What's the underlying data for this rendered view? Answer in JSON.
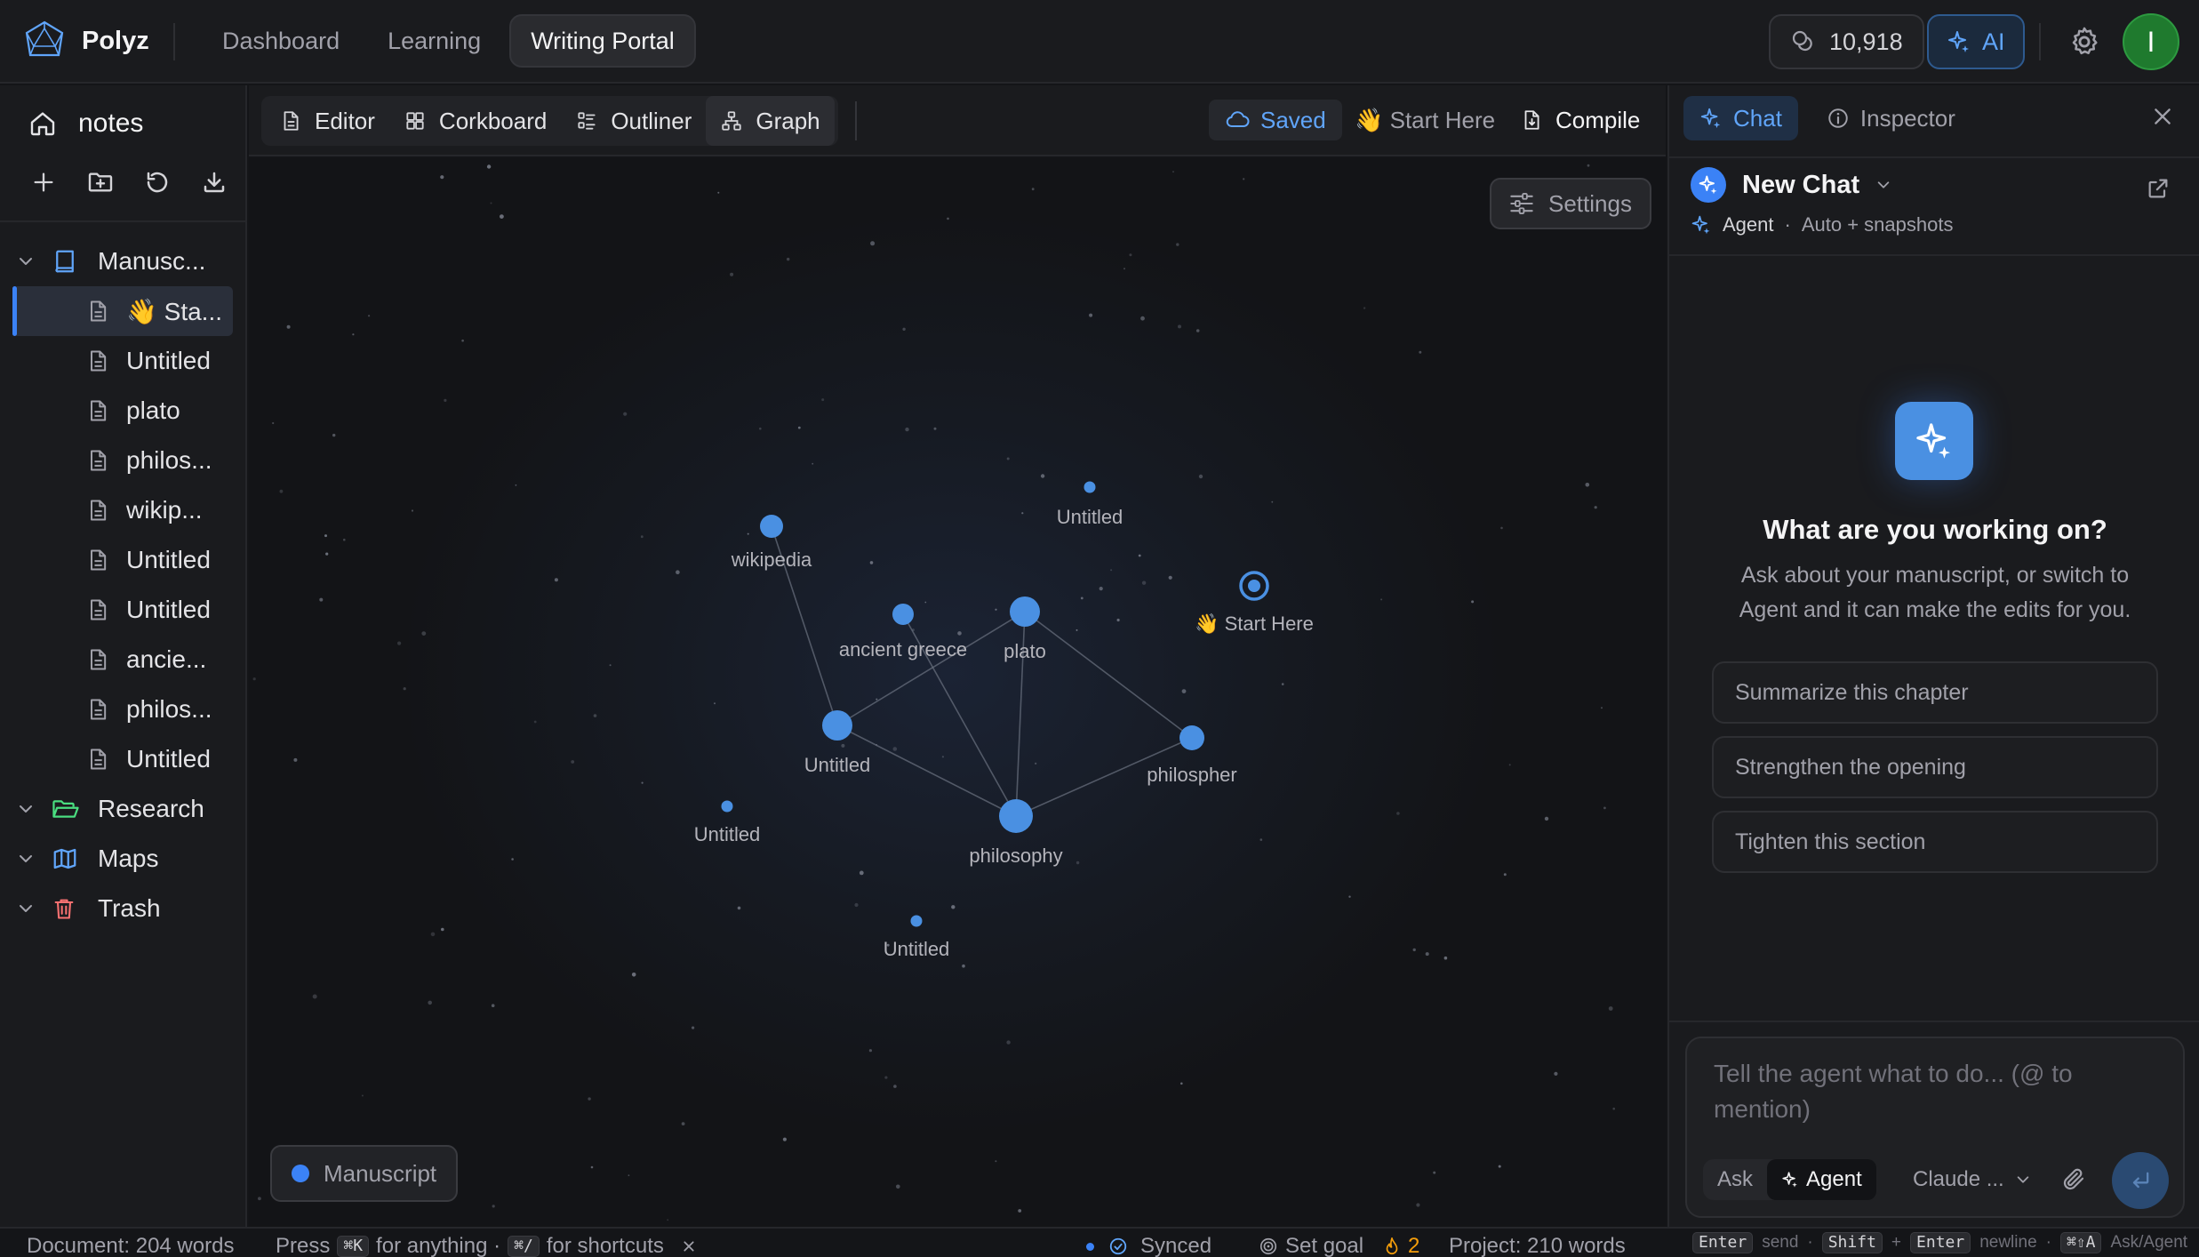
{
  "app": {
    "name": "Polyz",
    "nav": [
      {
        "label": "Dashboard",
        "active": false
      },
      {
        "label": "Learning",
        "active": false
      },
      {
        "label": "Writing Portal",
        "active": true
      }
    ],
    "credits": "10,918",
    "ai_label": "AI",
    "avatar_initial": "I",
    "accent_color": "#3b82f6"
  },
  "sidebar": {
    "home_label": "notes",
    "tree": [
      {
        "type": "folder",
        "label": "Manusc...",
        "icon": "book-icon"
      },
      {
        "type": "doc",
        "label": "👋 Sta...",
        "selected": true
      },
      {
        "type": "doc",
        "label": "Untitled"
      },
      {
        "type": "doc",
        "label": "plato"
      },
      {
        "type": "doc",
        "label": "philos..."
      },
      {
        "type": "doc",
        "label": "wikip..."
      },
      {
        "type": "doc",
        "label": "Untitled"
      },
      {
        "type": "doc",
        "label": "Untitled"
      },
      {
        "type": "doc",
        "label": "ancie..."
      },
      {
        "type": "doc",
        "label": "philos..."
      },
      {
        "type": "doc",
        "label": "Untitled"
      },
      {
        "type": "folder",
        "label": "Research",
        "icon": "folder-open-icon"
      },
      {
        "type": "folder",
        "label": "Maps",
        "icon": "map-icon"
      },
      {
        "type": "folder",
        "label": "Trash",
        "icon": "trash-icon"
      }
    ]
  },
  "toolbar": {
    "tabs": [
      {
        "label": "Editor",
        "icon": "document-icon"
      },
      {
        "label": "Corkboard",
        "icon": "grid-icon"
      },
      {
        "label": "Outliner",
        "icon": "list-icon"
      },
      {
        "label": "Graph",
        "icon": "graph-icon",
        "active": true
      }
    ],
    "saved_label": "Saved",
    "start_here_label": "👋 Start Here",
    "compile_label": "Compile"
  },
  "graph": {
    "settings_label": "Settings",
    "legend_label": "Manuscript",
    "nodes": [
      {
        "id": "wikipedia",
        "label": "wikipedia"
      },
      {
        "id": "untitled_top",
        "label": "Untitled"
      },
      {
        "id": "ancient_greece",
        "label": "ancient greece"
      },
      {
        "id": "plato",
        "label": "plato"
      },
      {
        "id": "start_here",
        "label": "👋 Start Here"
      },
      {
        "id": "untitled_mid",
        "label": "Untitled"
      },
      {
        "id": "philospher",
        "label": "philospher"
      },
      {
        "id": "untitled_left",
        "label": "Untitled"
      },
      {
        "id": "philosophy",
        "label": "philosophy"
      },
      {
        "id": "untitled_bottom",
        "label": "Untitled"
      }
    ]
  },
  "right_panel": {
    "tabs": [
      {
        "label": "Chat",
        "active": true
      },
      {
        "label": "Inspector",
        "active": false
      }
    ],
    "chat_title": "New Chat",
    "agent_label": "Agent",
    "mode_sub": "Auto + snapshots",
    "hero_title": "What are you working on?",
    "hero_sub": "Ask about your manuscript, or switch to Agent and it can make the edits for you.",
    "suggestions": [
      "Summarize this chapter",
      "Strengthen the opening",
      "Tighten this section"
    ],
    "composer_placeholder": "Tell the agent what to do... (@ to mention)",
    "mode_ask": "Ask",
    "mode_agent": "Agent",
    "model_label": "Claude ..."
  },
  "status": {
    "document_words": "Document: 204 words",
    "press": "Press",
    "kbd_k": "⌘K",
    "for_anything": "for anything ·",
    "kbd_slash": "⌘/",
    "for_shortcuts": "for shortcuts",
    "synced": "Synced",
    "set_goal": "Set goal",
    "streak": "2",
    "project_words": "Project: 210 words",
    "hint_enter": "Enter",
    "hint_send": "send",
    "hint_shift": "Shift",
    "hint_plus": "+",
    "hint_enter2": "Enter",
    "hint_newline": "newline",
    "hint_kbd3": "⌘⇧A",
    "hint_askagent": "Ask/Agent"
  }
}
